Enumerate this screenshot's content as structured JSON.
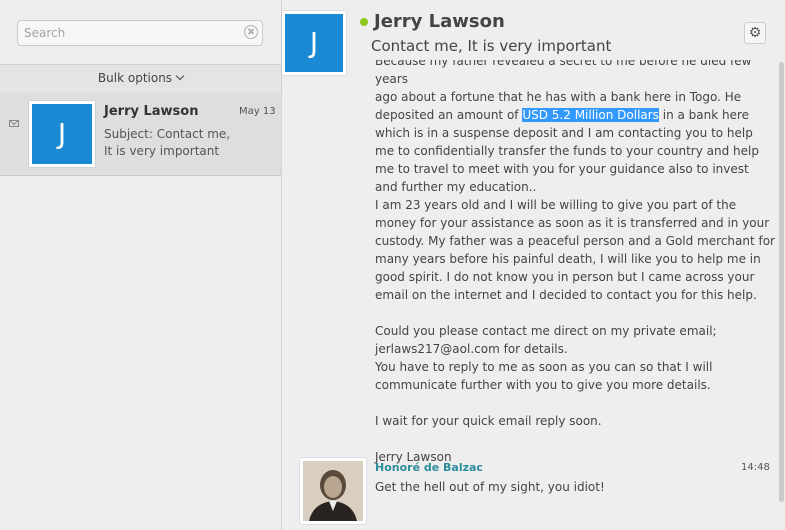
{
  "search": {
    "placeholder": "Search"
  },
  "bulk_options": {
    "label": "Bulk options"
  },
  "message_list": [
    {
      "sender": "Jerry Lawson",
      "avatar_initial": "J",
      "date": "May 13",
      "subject_line1": "Subject: Contact me,",
      "subject_line2": "It is very important"
    }
  ],
  "message": {
    "sender": "Jerry Lawson",
    "avatar_initial": "J",
    "subject": "Contact me, It is very important",
    "status_color": "#8cc81e",
    "body_top_partial": "Because my father revealed a secret to me before he died few years",
    "body_p1_before": "ago about a fortune that he has with a bank here in Togo. He deposited an amount of ",
    "body_p1_highlight": "USD 5.2 Million Dollars",
    "body_p1_after": " in a bank here which is in a suspense deposit and I am contacting you to help me to confidentially transfer the funds to your country and help me to travel to meet with you for your guidance also to invest and further my education..",
    "body_p2": "I am 23 years old and I will be willing to give you part of the money for your assistance as soon as it is transferred and in your custody. My father was a peaceful person and a Gold merchant for many years before his painful death, I will like you to help me in good spirit. I do not know you in person but I came across your email on the internet and I decided to contact you for this help.",
    "body_p3": "Could you please contact me direct on my private email; jerlaws217@aol.com for details.",
    "body_p4": "You have to reply to me as soon as you can so that I will communicate further with you to give you more details.",
    "body_p5": "I wait for your quick email reply soon.",
    "signature": "Jerry Lawson"
  },
  "reply": {
    "sender": "Honoré de Balzac",
    "time": "14:48",
    "text": "Get the hell out of my sight, you idiot!"
  },
  "colors": {
    "avatar_blue": "#1a8ad4",
    "highlight": "#3399ff",
    "reply_name": "#2b8c9c"
  }
}
